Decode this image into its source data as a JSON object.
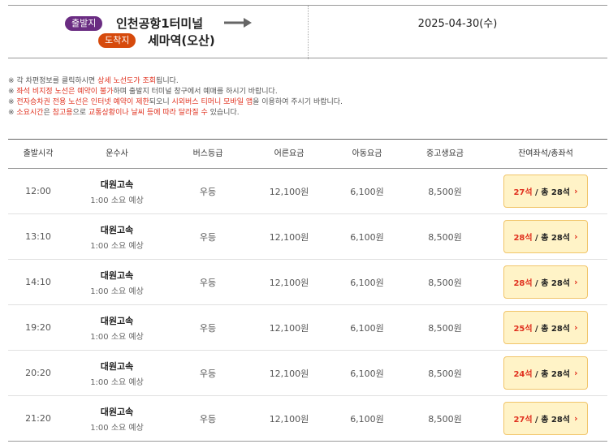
{
  "route": {
    "departure_badge": "출발지",
    "departure": "인천공항1터미널",
    "arrival_badge": "도착지",
    "arrival": "세마역(오산)",
    "date": "2025-04-30(수)",
    "badge_colors": {
      "departure": "#6a2c82",
      "arrival": "#d64a0c"
    }
  },
  "notices": [
    {
      "parts": [
        {
          "t": "※ 각 차편정보를 클릭하시면 ",
          "hl": false
        },
        {
          "t": "상세 노선도가 조회",
          "hl": true
        },
        {
          "t": "됩니다.",
          "hl": false
        }
      ]
    },
    {
      "parts": [
        {
          "t": "※ ",
          "hl": false
        },
        {
          "t": "좌석 비지정 노선은 예약이 불가",
          "hl": true
        },
        {
          "t": "하며 출발지 터미널 창구에서 예매를 하시기 바랍니다.",
          "hl": false
        }
      ]
    },
    {
      "parts": [
        {
          "t": "※ ",
          "hl": false
        },
        {
          "t": "전자승차권 전용 노선은 인터넷 예약이 제한",
          "hl": true
        },
        {
          "t": "되오니 ",
          "hl": false
        },
        {
          "t": "시외버스 티머니 모바일 앱",
          "hl": true
        },
        {
          "t": "을 이용하여 주시기 바랍니다.",
          "hl": false
        }
      ]
    },
    {
      "parts": [
        {
          "t": "※ ",
          "hl": false
        },
        {
          "t": "소요시간",
          "hl": true
        },
        {
          "t": "은 ",
          "hl": false
        },
        {
          "t": "참고용",
          "hl": true
        },
        {
          "t": "으로 ",
          "hl": false
        },
        {
          "t": "교통상황이나 날씨 등에 따라 달라질 수",
          "hl": true
        },
        {
          "t": " 있습니다.",
          "hl": false
        }
      ]
    }
  ],
  "table": {
    "headers": [
      "출발시각",
      "운수사",
      "버스등급",
      "어른요금",
      "아동요금",
      "중고생요금",
      "잔여좌석/총좌석"
    ],
    "rows": [
      {
        "time": "12:00",
        "company": "대원고속",
        "duration": "1:00 소요 예상",
        "grade": "우등",
        "adult": "12,100원",
        "child": "6,100원",
        "teen": "8,500원",
        "remaining": "27석",
        "total": " / 총 28석"
      },
      {
        "time": "13:10",
        "company": "대원고속",
        "duration": "1:00 소요 예상",
        "grade": "우등",
        "adult": "12,100원",
        "child": "6,100원",
        "teen": "8,500원",
        "remaining": "28석",
        "total": " / 총 28석"
      },
      {
        "time": "14:10",
        "company": "대원고속",
        "duration": "1:00 소요 예상",
        "grade": "우등",
        "adult": "12,100원",
        "child": "6,100원",
        "teen": "8,500원",
        "remaining": "28석",
        "total": " / 총 28석"
      },
      {
        "time": "19:20",
        "company": "대원고속",
        "duration": "1:00 소요 예상",
        "grade": "우등",
        "adult": "12,100원",
        "child": "6,100원",
        "teen": "8,500원",
        "remaining": "25석",
        "total": " / 총 28석"
      },
      {
        "time": "20:20",
        "company": "대원고속",
        "duration": "1:00 소요 예상",
        "grade": "우등",
        "adult": "12,100원",
        "child": "6,100원",
        "teen": "8,500원",
        "remaining": "24석",
        "total": " / 총 28석"
      },
      {
        "time": "21:20",
        "company": "대원고속",
        "duration": "1:00 소요 예상",
        "grade": "우등",
        "adult": "12,100원",
        "child": "6,100원",
        "teen": "8,500원",
        "remaining": "27석",
        "total": " / 총 28석"
      }
    ]
  },
  "icons": {
    "route_arrow": "arrow-right-icon",
    "seat_chevron": "chevron-right-icon"
  },
  "colors": {
    "highlight": "#e0301e",
    "seat_button_bg": "#fff3c7",
    "seat_button_border": "#f1c56a"
  }
}
